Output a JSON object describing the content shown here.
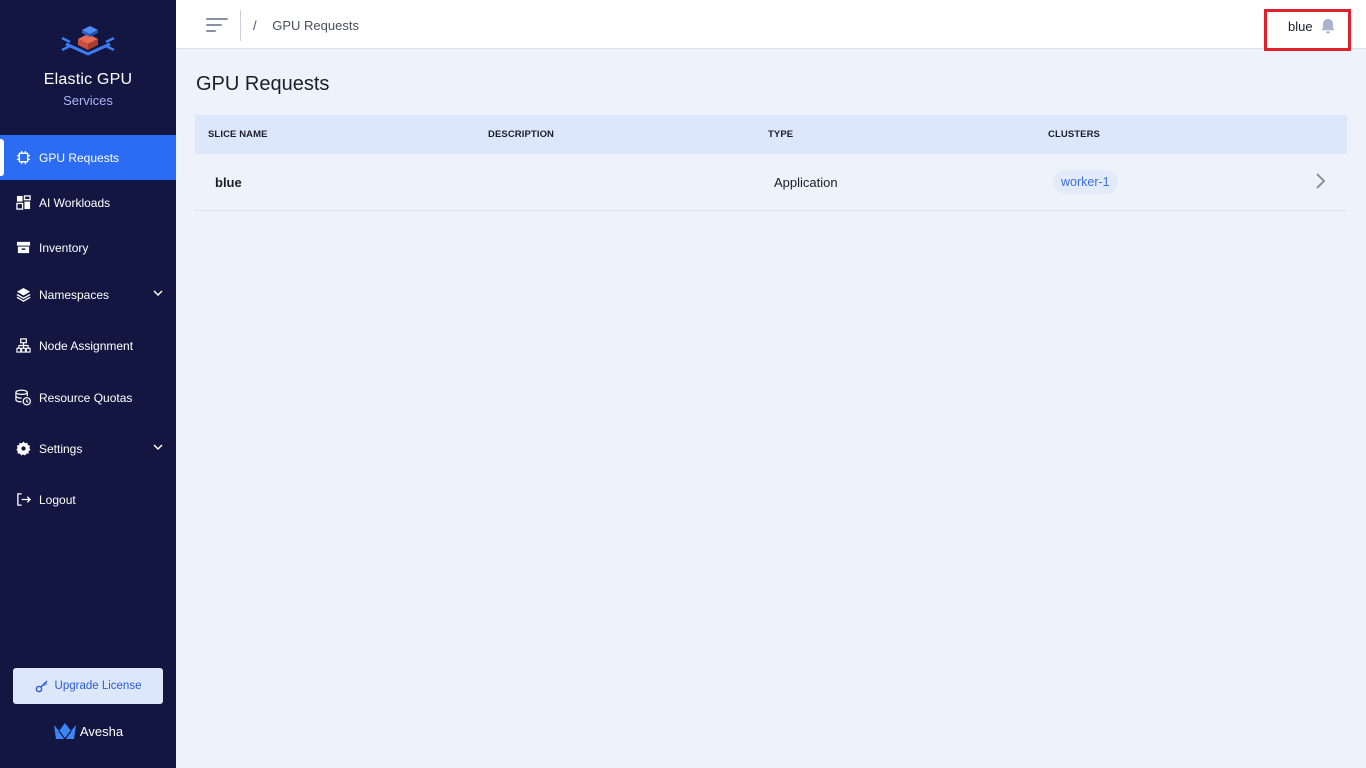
{
  "brand": {
    "title": "Elastic GPU",
    "subtitle": "Services"
  },
  "sidebar": {
    "items": [
      {
        "label": "GPU Requests",
        "icon": "chip-icon",
        "active": true
      },
      {
        "label": "AI Workloads",
        "icon": "dashboard-icon"
      },
      {
        "label": "Inventory",
        "icon": "archive-icon"
      },
      {
        "label": "Namespaces",
        "icon": "layers-icon",
        "expandable": true
      },
      {
        "label": "Node Assignment",
        "icon": "sitemap-icon"
      },
      {
        "label": "Resource Quotas",
        "icon": "database-clock-icon"
      },
      {
        "label": "Settings",
        "icon": "gear-icon",
        "expandable": true
      },
      {
        "label": "Logout",
        "icon": "logout-icon"
      }
    ],
    "upgrade_label": "Upgrade License",
    "footer_brand": "Avesha"
  },
  "topbar": {
    "breadcrumb_sep": "/",
    "breadcrumb_current": "GPU Requests",
    "user_name": "blue"
  },
  "page": {
    "title": "GPU Requests",
    "columns": [
      "SLICE NAME",
      "DESCRIPTION",
      "TYPE",
      "CLUSTERS"
    ],
    "rows": [
      {
        "slice_name": "blue",
        "description": "",
        "type": "Application",
        "clusters": [
          "worker-1"
        ]
      }
    ]
  },
  "colors": {
    "sidebar_bg": "#141642",
    "active": "#2b6cf3",
    "header_bg": "#dde7fb",
    "highlight": "#e0202a"
  }
}
